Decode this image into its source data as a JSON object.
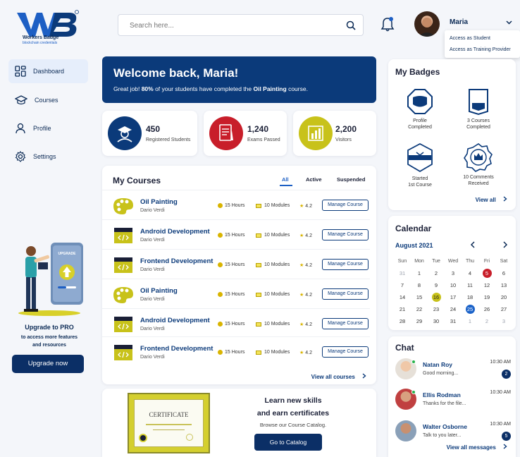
{
  "brand": {
    "name": "Workers Badge",
    "tagline": "blockchain credentials",
    "mark": "WB"
  },
  "search": {
    "placeholder": "Search here..."
  },
  "user": {
    "name": "Maria"
  },
  "user_menu": [
    "Access as Student",
    "Access as Training Provider"
  ],
  "sidebar": {
    "items": [
      {
        "label": "Dashboard",
        "icon": "grid-icon",
        "active": true
      },
      {
        "label": "Courses",
        "icon": "graduation-cap-icon"
      },
      {
        "label": "Profile",
        "icon": "user-icon"
      },
      {
        "label": "Settings",
        "icon": "gear-icon"
      }
    ],
    "promo": {
      "screen_label": "UPGRADE",
      "title": "Upgrade to PRO",
      "subtitle": "to access more features\nand resources",
      "button": "Upgrade now"
    }
  },
  "welcome": {
    "title": "Welcome back, Maria!",
    "text_a": "Great job! ",
    "pct": "80%",
    "text_b": " of your students have completed the ",
    "course": "Oil Painting",
    "text_c": " course."
  },
  "stats": [
    {
      "value": "450",
      "label": "Registered Students",
      "color": "#0b3a7a"
    },
    {
      "value": "1,240",
      "label": "Exams Passed",
      "color": "#c81e2a"
    },
    {
      "value": "2,200",
      "label": "Visitors",
      "color": "#c8c21a"
    }
  ],
  "my_courses": {
    "title": "My Courses",
    "tabs": [
      "All",
      "Active",
      "Suspended"
    ],
    "active_tab": "All",
    "rows": [
      {
        "title": "Oil Painting",
        "author": "Dario Verdi",
        "hours": "15 Hours",
        "modules": "10 Modules",
        "rating": "4.2",
        "button": "Manage Course",
        "kind": "palette"
      },
      {
        "title": "Android Development",
        "author": "Dario Verdi",
        "hours": "15 Hours",
        "modules": "10 Modules",
        "rating": "4.2",
        "button": "Manage Course",
        "kind": "code"
      },
      {
        "title": "Frontend Development",
        "author": "Dario Verdi",
        "hours": "15 Hours",
        "modules": "10 Modules",
        "rating": "4.2",
        "button": "Manage Course",
        "kind": "code"
      },
      {
        "title": "Oil Painting",
        "author": "Dario Verdi",
        "hours": "15 Hours",
        "modules": "10 Modules",
        "rating": "4.2",
        "button": "Manage Course",
        "kind": "palette"
      },
      {
        "title": "Android Development",
        "author": "Dario Verdi",
        "hours": "15 Hours",
        "modules": "10 Modules",
        "rating": "4.2",
        "button": "Manage Course",
        "kind": "code"
      },
      {
        "title": "Frontend Development",
        "author": "Dario Verdi",
        "hours": "15 Hours",
        "modules": "10 Modules",
        "rating": "4.2",
        "button": "Manage Course",
        "kind": "code"
      }
    ],
    "view_all": "View all courses"
  },
  "catalog": {
    "cert_label": "CERTIFICATE",
    "line1": "Learn new skills",
    "line2": "and earn certificates",
    "sub": "Browse our Course Catalog.",
    "button": "Go to Catalog"
  },
  "badges": {
    "title": "My Badges",
    "items": [
      {
        "label": "Profile\nCompleted"
      },
      {
        "label": "3 Courses\nCompleted"
      },
      {
        "label": "Started\n1st Course"
      },
      {
        "label": "10 Comments\nReceived"
      }
    ],
    "view_all": "View all"
  },
  "calendar": {
    "title": "Calendar",
    "month": "August 2021",
    "weekdays": [
      "Sun",
      "Mon",
      "Tue",
      "Wed",
      "Thu",
      "Fri",
      "Sat"
    ],
    "cells": [
      "31",
      "1",
      "2",
      "3",
      "4",
      "5",
      "6",
      "7",
      "8",
      "9",
      "10",
      "11",
      "12",
      "13",
      "14",
      "15",
      "16",
      "17",
      "18",
      "19",
      "20",
      "21",
      "22",
      "23",
      "24",
      "25",
      "26",
      "27",
      "28",
      "29",
      "30",
      "31",
      "1",
      "2",
      "3"
    ]
  },
  "chat": {
    "title": "Chat",
    "items": [
      {
        "name": "Natan Roy",
        "message": "Good morning...",
        "time": "10:30 AM",
        "count": "2",
        "online": true
      },
      {
        "name": "Ellis Rodman",
        "message": "Thanks for the file...",
        "time": "10:30 AM",
        "count": "",
        "online": true
      },
      {
        "name": "Walter Osborne",
        "message": "Talk to you later...",
        "time": "10:30 AM",
        "count": "5",
        "online": false
      }
    ],
    "view_all": "View all messages"
  }
}
